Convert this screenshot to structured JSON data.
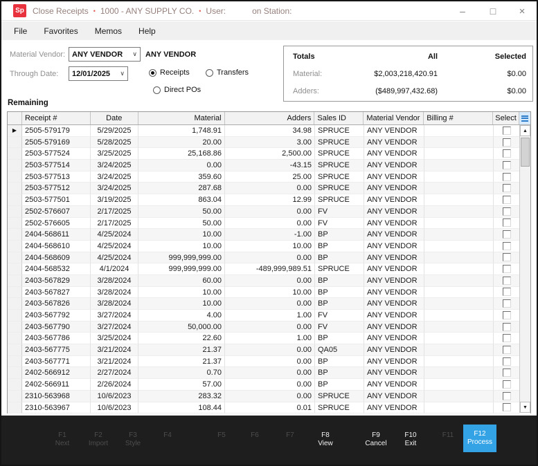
{
  "colors": {
    "logo_red": "#e8323e",
    "accent_blue": "#33a3e6",
    "title_text": "#97817d"
  },
  "titlebar": {
    "logo": "Sp",
    "app": "Close Receipts",
    "company": "1000 - ANY SUPPLY CO.",
    "user_label": "User:",
    "station_label": "on Station:",
    "separator": "•",
    "minimize": "–",
    "maximize": "□",
    "close": "×"
  },
  "menu": {
    "items": [
      "File",
      "Favorites",
      "Memos",
      "Help"
    ]
  },
  "form": {
    "material_vendor_label": "Material Vendor:",
    "material_vendor_value": "ANY VENDOR",
    "material_vendor_name": "ANY VENDOR",
    "through_date_label": "Through Date:",
    "through_date_value": "12/01/2025",
    "chevron": "∨",
    "radios": [
      {
        "label": "Receipts",
        "selected": true
      },
      {
        "label": "Transfers",
        "selected": false
      },
      {
        "label": "Direct POs",
        "selected": false
      }
    ]
  },
  "totals": {
    "title": "Totals",
    "col_all": "All",
    "col_selected": "Selected",
    "rows": [
      {
        "label": "Material:",
        "all": "$2,003,218,420.91",
        "selected": "$0.00"
      },
      {
        "label": "Adders:",
        "all": "($489,997,432.68)",
        "selected": "$0.00"
      }
    ]
  },
  "section_label": "Remaining",
  "table": {
    "columns": [
      "Receipt #",
      "Date",
      "Material",
      "Adders",
      "Sales ID",
      "Material Vendor",
      "Billing #",
      "Select"
    ],
    "current_row": 0,
    "current_row_marker": "▶",
    "rows": [
      [
        "2505-579179",
        "5/29/2025",
        "1,748.91",
        "34.98",
        "SPRUCE",
        "ANY VENDOR",
        ""
      ],
      [
        "2505-579169",
        "5/28/2025",
        "20.00",
        "3.00",
        "SPRUCE",
        "ANY VENDOR",
        ""
      ],
      [
        "2503-577524",
        "3/25/2025",
        "25,168.86",
        "2,500.00",
        "SPRUCE",
        "ANY VENDOR",
        ""
      ],
      [
        "2503-577514",
        "3/24/2025",
        "0.00",
        "-43.15",
        "SPRUCE",
        "ANY VENDOR",
        ""
      ],
      [
        "2503-577513",
        "3/24/2025",
        "359.60",
        "25.00",
        "SPRUCE",
        "ANY VENDOR",
        ""
      ],
      [
        "2503-577512",
        "3/24/2025",
        "287.68",
        "0.00",
        "SPRUCE",
        "ANY VENDOR",
        ""
      ],
      [
        "2503-577501",
        "3/19/2025",
        "863.04",
        "12.99",
        "SPRUCE",
        "ANY VENDOR",
        ""
      ],
      [
        "2502-576607",
        "2/17/2025",
        "50.00",
        "0.00",
        "FV",
        "ANY VENDOR",
        ""
      ],
      [
        "2502-576605",
        "2/17/2025",
        "50.00",
        "0.00",
        "FV",
        "ANY VENDOR",
        ""
      ],
      [
        "2404-568611",
        "4/25/2024",
        "10.00",
        "-1.00",
        "BP",
        "ANY VENDOR",
        ""
      ],
      [
        "2404-568610",
        "4/25/2024",
        "10.00",
        "10.00",
        "BP",
        "ANY VENDOR",
        ""
      ],
      [
        "2404-568609",
        "4/25/2024",
        "999,999,999.00",
        "0.00",
        "BP",
        "ANY VENDOR",
        ""
      ],
      [
        "2404-568532",
        "4/1/2024",
        "999,999,999.00",
        "-489,999,989.51",
        "SPRUCE",
        "ANY VENDOR",
        ""
      ],
      [
        "2403-567829",
        "3/28/2024",
        "60.00",
        "0.00",
        "BP",
        "ANY VENDOR",
        ""
      ],
      [
        "2403-567827",
        "3/28/2024",
        "10.00",
        "10.00",
        "BP",
        "ANY VENDOR",
        ""
      ],
      [
        "2403-567826",
        "3/28/2024",
        "10.00",
        "0.00",
        "BP",
        "ANY VENDOR",
        ""
      ],
      [
        "2403-567792",
        "3/27/2024",
        "4.00",
        "1.00",
        "FV",
        "ANY VENDOR",
        ""
      ],
      [
        "2403-567790",
        "3/27/2024",
        "50,000.00",
        "0.00",
        "FV",
        "ANY VENDOR",
        ""
      ],
      [
        "2403-567786",
        "3/25/2024",
        "22.60",
        "1.00",
        "BP",
        "ANY VENDOR",
        ""
      ],
      [
        "2403-567775",
        "3/21/2024",
        "21.37",
        "0.00",
        "QA05",
        "ANY VENDOR",
        ""
      ],
      [
        "2403-567771",
        "3/21/2024",
        "21.37",
        "0.00",
        "BP",
        "ANY VENDOR",
        ""
      ],
      [
        "2402-566912",
        "2/27/2024",
        "0.70",
        "0.00",
        "BP",
        "ANY VENDOR",
        ""
      ],
      [
        "2402-566911",
        "2/26/2024",
        "57.00",
        "0.00",
        "BP",
        "ANY VENDOR",
        ""
      ],
      [
        "2310-563968",
        "10/6/2023",
        "283.32",
        "0.00",
        "SPRUCE",
        "ANY VENDOR",
        ""
      ],
      [
        "2310-563967",
        "10/6/2023",
        "108.44",
        "0.01",
        "SPRUCE",
        "ANY VENDOR",
        ""
      ]
    ]
  },
  "fnbar": {
    "keys": [
      {
        "key": "F1",
        "label": "Next",
        "state": "disabled"
      },
      {
        "key": "F2",
        "label": "Import",
        "state": "disabled"
      },
      {
        "key": "F3",
        "label": "Style",
        "state": "disabled"
      },
      {
        "key": "F4",
        "label": "",
        "state": "disabled"
      },
      {
        "key": "F5",
        "label": "",
        "state": "disabled"
      },
      {
        "key": "F6",
        "label": "",
        "state": "disabled"
      },
      {
        "key": "F7",
        "label": "",
        "state": "disabled"
      },
      {
        "key": "F8",
        "label": "View",
        "state": "enabled"
      },
      {
        "key": "F9",
        "label": "Cancel",
        "state": "enabled"
      },
      {
        "key": "F10",
        "label": "Exit",
        "state": "enabled"
      },
      {
        "key": "F11",
        "label": "",
        "state": "disabled"
      },
      {
        "key": "F12",
        "label": "Process",
        "state": "primary"
      }
    ]
  }
}
